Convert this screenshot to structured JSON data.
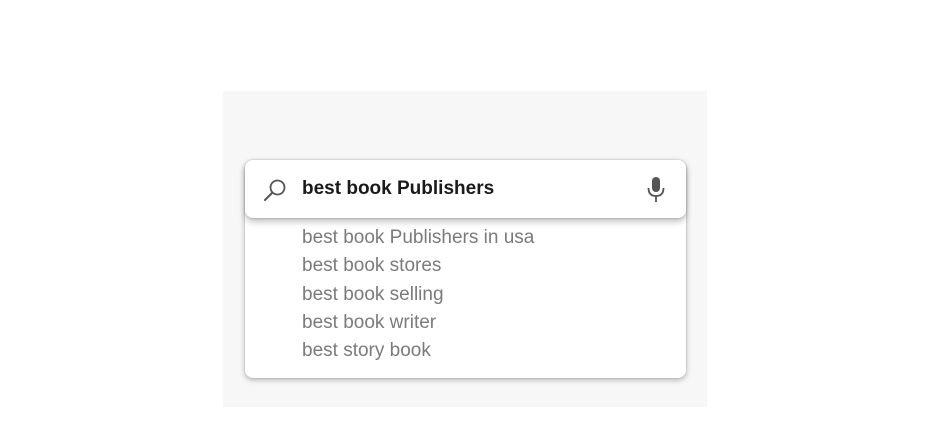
{
  "search": {
    "value": "best book Publishers",
    "search_icon": "search-icon",
    "mic_icon": "microphone-icon"
  },
  "suggestions": [
    "best book Publishers in usa",
    "best book stores",
    "best book selling",
    "best book writer",
    "best story book"
  ],
  "colors": {
    "panel_background": "#f7f7f7",
    "query_text": "#1a1a1a",
    "suggestion_text": "#7b7b7b",
    "icon": "#555555"
  }
}
